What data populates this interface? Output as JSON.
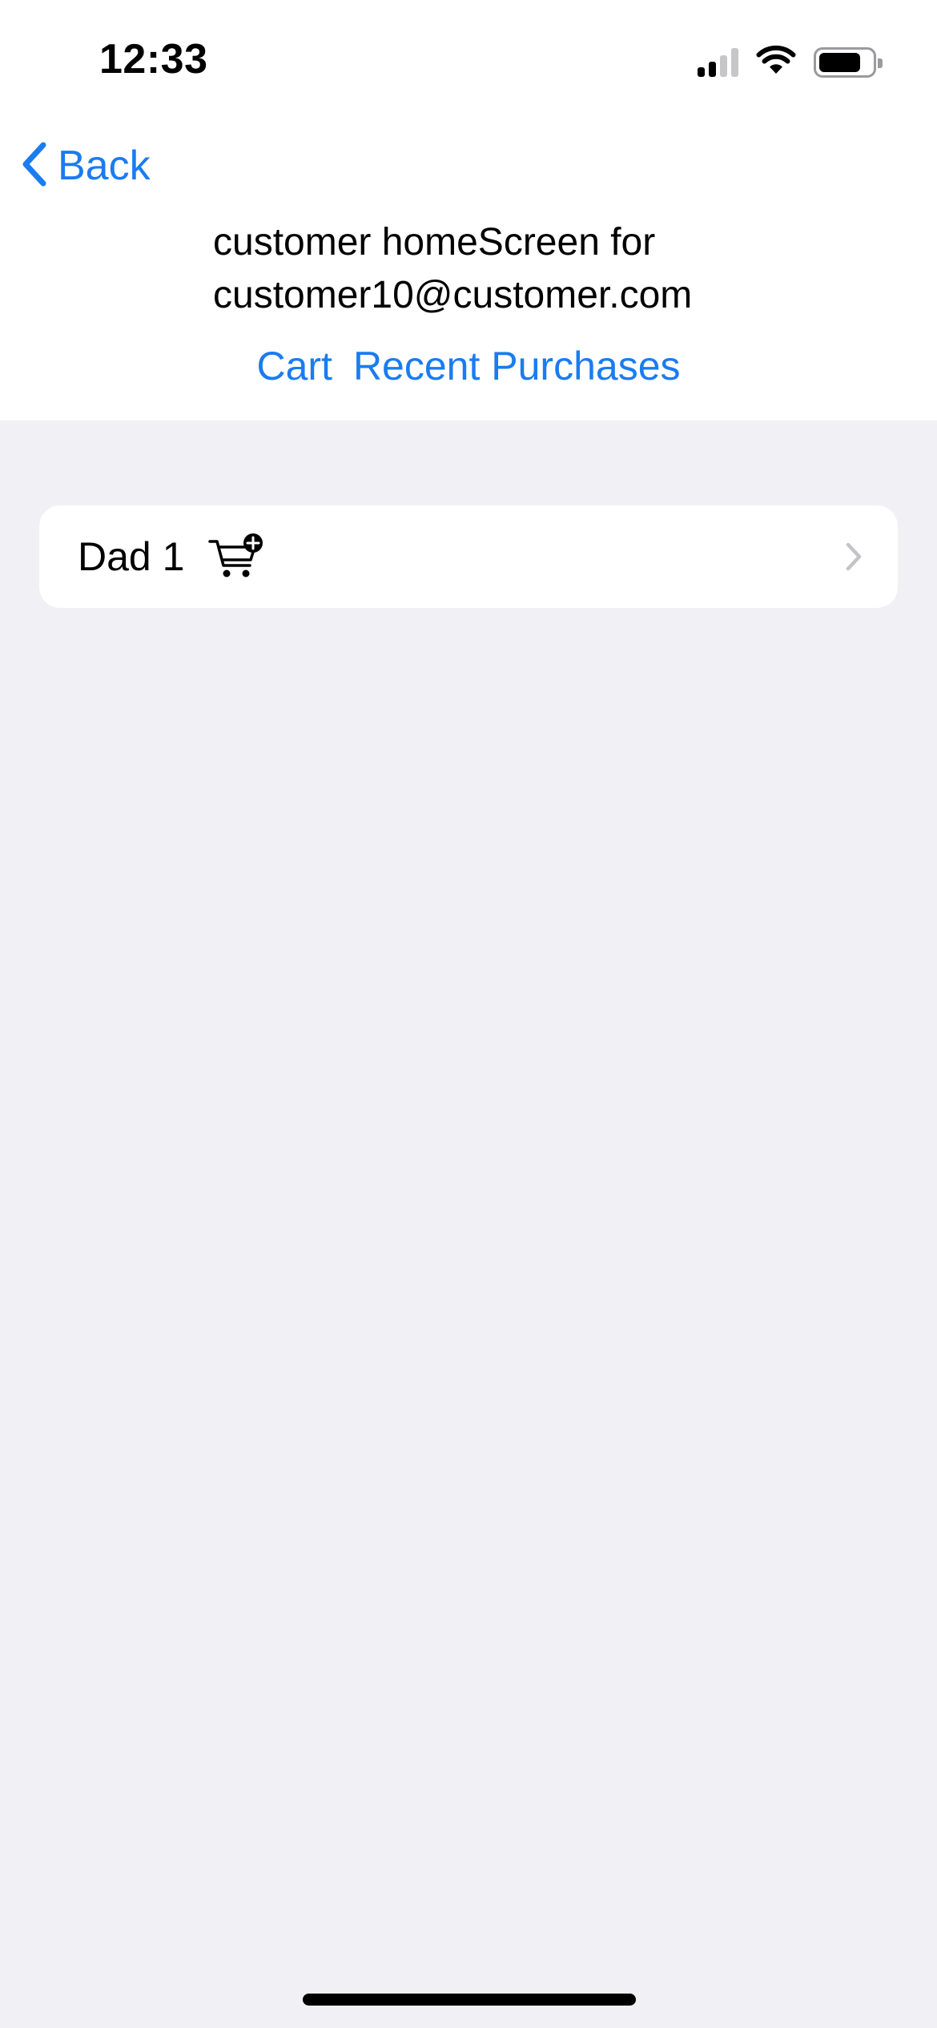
{
  "status_bar": {
    "time": "12:33",
    "signal_icon": "cellular-signal-icon",
    "wifi_icon": "wifi-icon",
    "battery_icon": "battery-icon",
    "signal_bars_filled": 2,
    "signal_bars_total": 4,
    "battery_level": 0.8
  },
  "nav": {
    "back_label": "Back",
    "back_icon": "chevron-left-icon"
  },
  "header": {
    "title": "customer homeScreen for customer10@customer.com",
    "links": [
      {
        "label": "Cart"
      },
      {
        "label": "Recent Purchases"
      }
    ]
  },
  "list": {
    "items": [
      {
        "label": "Dad 1",
        "icon": "cart-add-icon",
        "accessory": "chevron-right-icon"
      }
    ]
  },
  "colors": {
    "accent": "#1a7cf0",
    "background": "#f0f0f5",
    "card": "#ffffff",
    "chevron": "#c4c4c7"
  }
}
